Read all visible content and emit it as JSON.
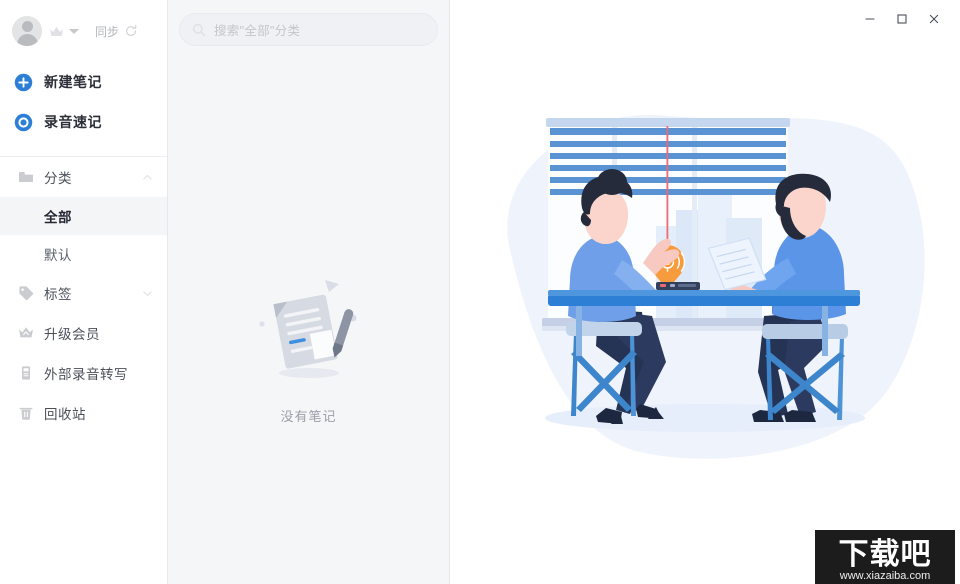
{
  "window": {
    "controls": [
      {
        "name": "minimize",
        "glyph": "minimize-icon"
      },
      {
        "name": "maximize",
        "glyph": "maximize-icon"
      },
      {
        "name": "close",
        "glyph": "close-icon"
      }
    ]
  },
  "sidebar": {
    "account": {
      "avatar_icon": "user-avatar-icon",
      "vip_icon": "crown-icon",
      "dropdown_icon": "chevron-down-icon",
      "sync_label": "同步",
      "sync_icon": "refresh-icon"
    },
    "actions": [
      {
        "label": "新建笔记",
        "icon": "plus-circle-icon"
      },
      {
        "label": "录音速记",
        "icon": "record-circle-icon"
      }
    ],
    "category": {
      "label": "分类",
      "icon": "folder-icon",
      "caret_icon": "chevron-up-icon",
      "items": [
        {
          "label": "全部",
          "selected": true
        },
        {
          "label": "默认",
          "selected": false
        }
      ]
    },
    "tags": {
      "label": "标签",
      "icon": "tag-icon",
      "caret_icon": "chevron-down-icon"
    },
    "items": [
      {
        "label": "升级会员",
        "icon": "crown-outline-icon"
      },
      {
        "label": "外部录音转写",
        "icon": "recorder-icon"
      },
      {
        "label": "回收站",
        "icon": "trash-icon"
      }
    ]
  },
  "list_panel": {
    "search": {
      "placeholder": "搜索\"全部\"分类",
      "value": "",
      "icon": "search-icon"
    },
    "empty_state": {
      "text": "没有笔记",
      "illustration": "empty-note-document-icon"
    }
  },
  "main": {
    "illustration": "two-people-meeting-recording-illustration",
    "watermark": {
      "title": "下载吧",
      "url": "www.xiazaiba.com"
    }
  },
  "colors": {
    "accent_blue": "#2d7fd6",
    "brand_blue": "#3c8ee0",
    "orange": "#f89b3c",
    "sidebar_bg": "#ffffff",
    "list_bg": "#f5f6f8",
    "selected_bg": "#f4f5f7",
    "text_dark": "#2b2f38",
    "text_muted": "#9aa0ab",
    "border": "#e6e8ec"
  }
}
